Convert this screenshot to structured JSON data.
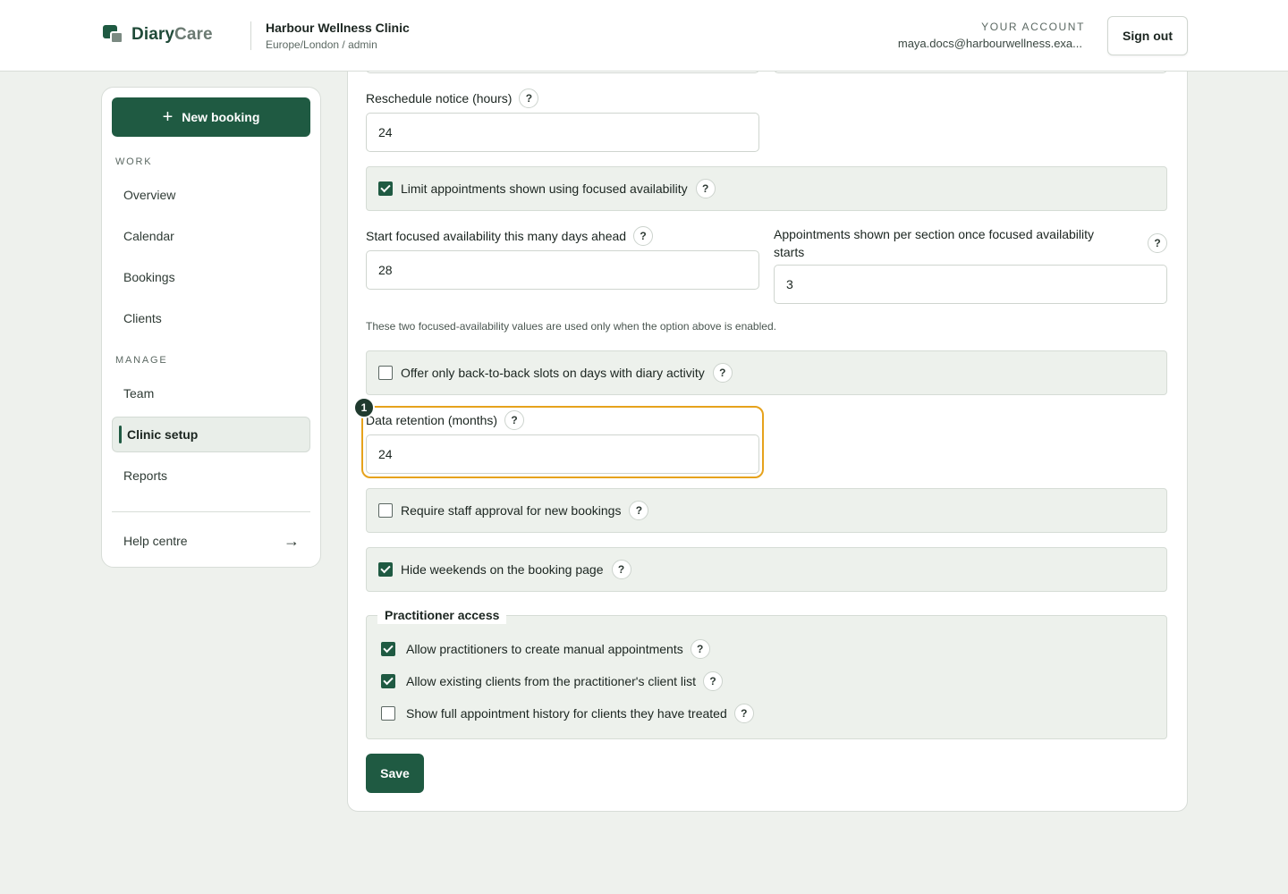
{
  "header": {
    "brand_primary": "Diary",
    "brand_secondary": "Care",
    "clinic_name": "Harbour Wellness Clinic",
    "clinic_sub": "Europe/London / admin",
    "account_label": "YOUR ACCOUNT",
    "account_email": "maya.docs@harbourwellness.exa...",
    "sign_out": "Sign out"
  },
  "sidebar": {
    "new_booking": "New booking",
    "work_label": "WORK",
    "work_items": [
      "Overview",
      "Calendar",
      "Bookings",
      "Clients"
    ],
    "manage_label": "MANAGE",
    "manage_items": [
      "Team",
      "Clinic setup",
      "Reports"
    ],
    "active_item": "Clinic setup",
    "help": "Help centre"
  },
  "form": {
    "reschedule_label": "Reschedule notice (hours)",
    "reschedule_value": "24",
    "focused_checkbox_label": "Limit appointments shown using focused availability",
    "focused_checked": true,
    "start_days_label": "Start focused availability this many days ahead",
    "start_days_value": "28",
    "per_section_label": "Appointments shown per section once focused availability starts",
    "per_section_value": "3",
    "hint": "These two focused-availability values are used only when the option above is enabled.",
    "back_to_back_label": "Offer only back-to-back slots on days with diary activity",
    "back_to_back_checked": false,
    "retention_label": "Data retention (months)",
    "retention_value": "24",
    "highlight_marker": "1",
    "approval_label": "Require staff approval for new bookings",
    "approval_checked": false,
    "weekends_label": "Hide weekends on the booking page",
    "weekends_checked": true,
    "practitioner_legend": "Practitioner access",
    "practitioner_options": [
      {
        "label": "Allow practitioners to create manual appointments",
        "checked": true
      },
      {
        "label": "Allow existing clients from the practitioner's client list",
        "checked": true
      },
      {
        "label": "Show full appointment history for clients they have treated",
        "checked": false
      }
    ],
    "save": "Save",
    "help_glyph": "?"
  },
  "icons": {
    "plus": "plus-icon",
    "arrow": "arrow-right-icon",
    "help": "question-icon"
  },
  "colors": {
    "primary": "#1f5a42",
    "highlight": "#e6a21c",
    "panel": "#edf1ec",
    "background": "#eef1ed"
  }
}
